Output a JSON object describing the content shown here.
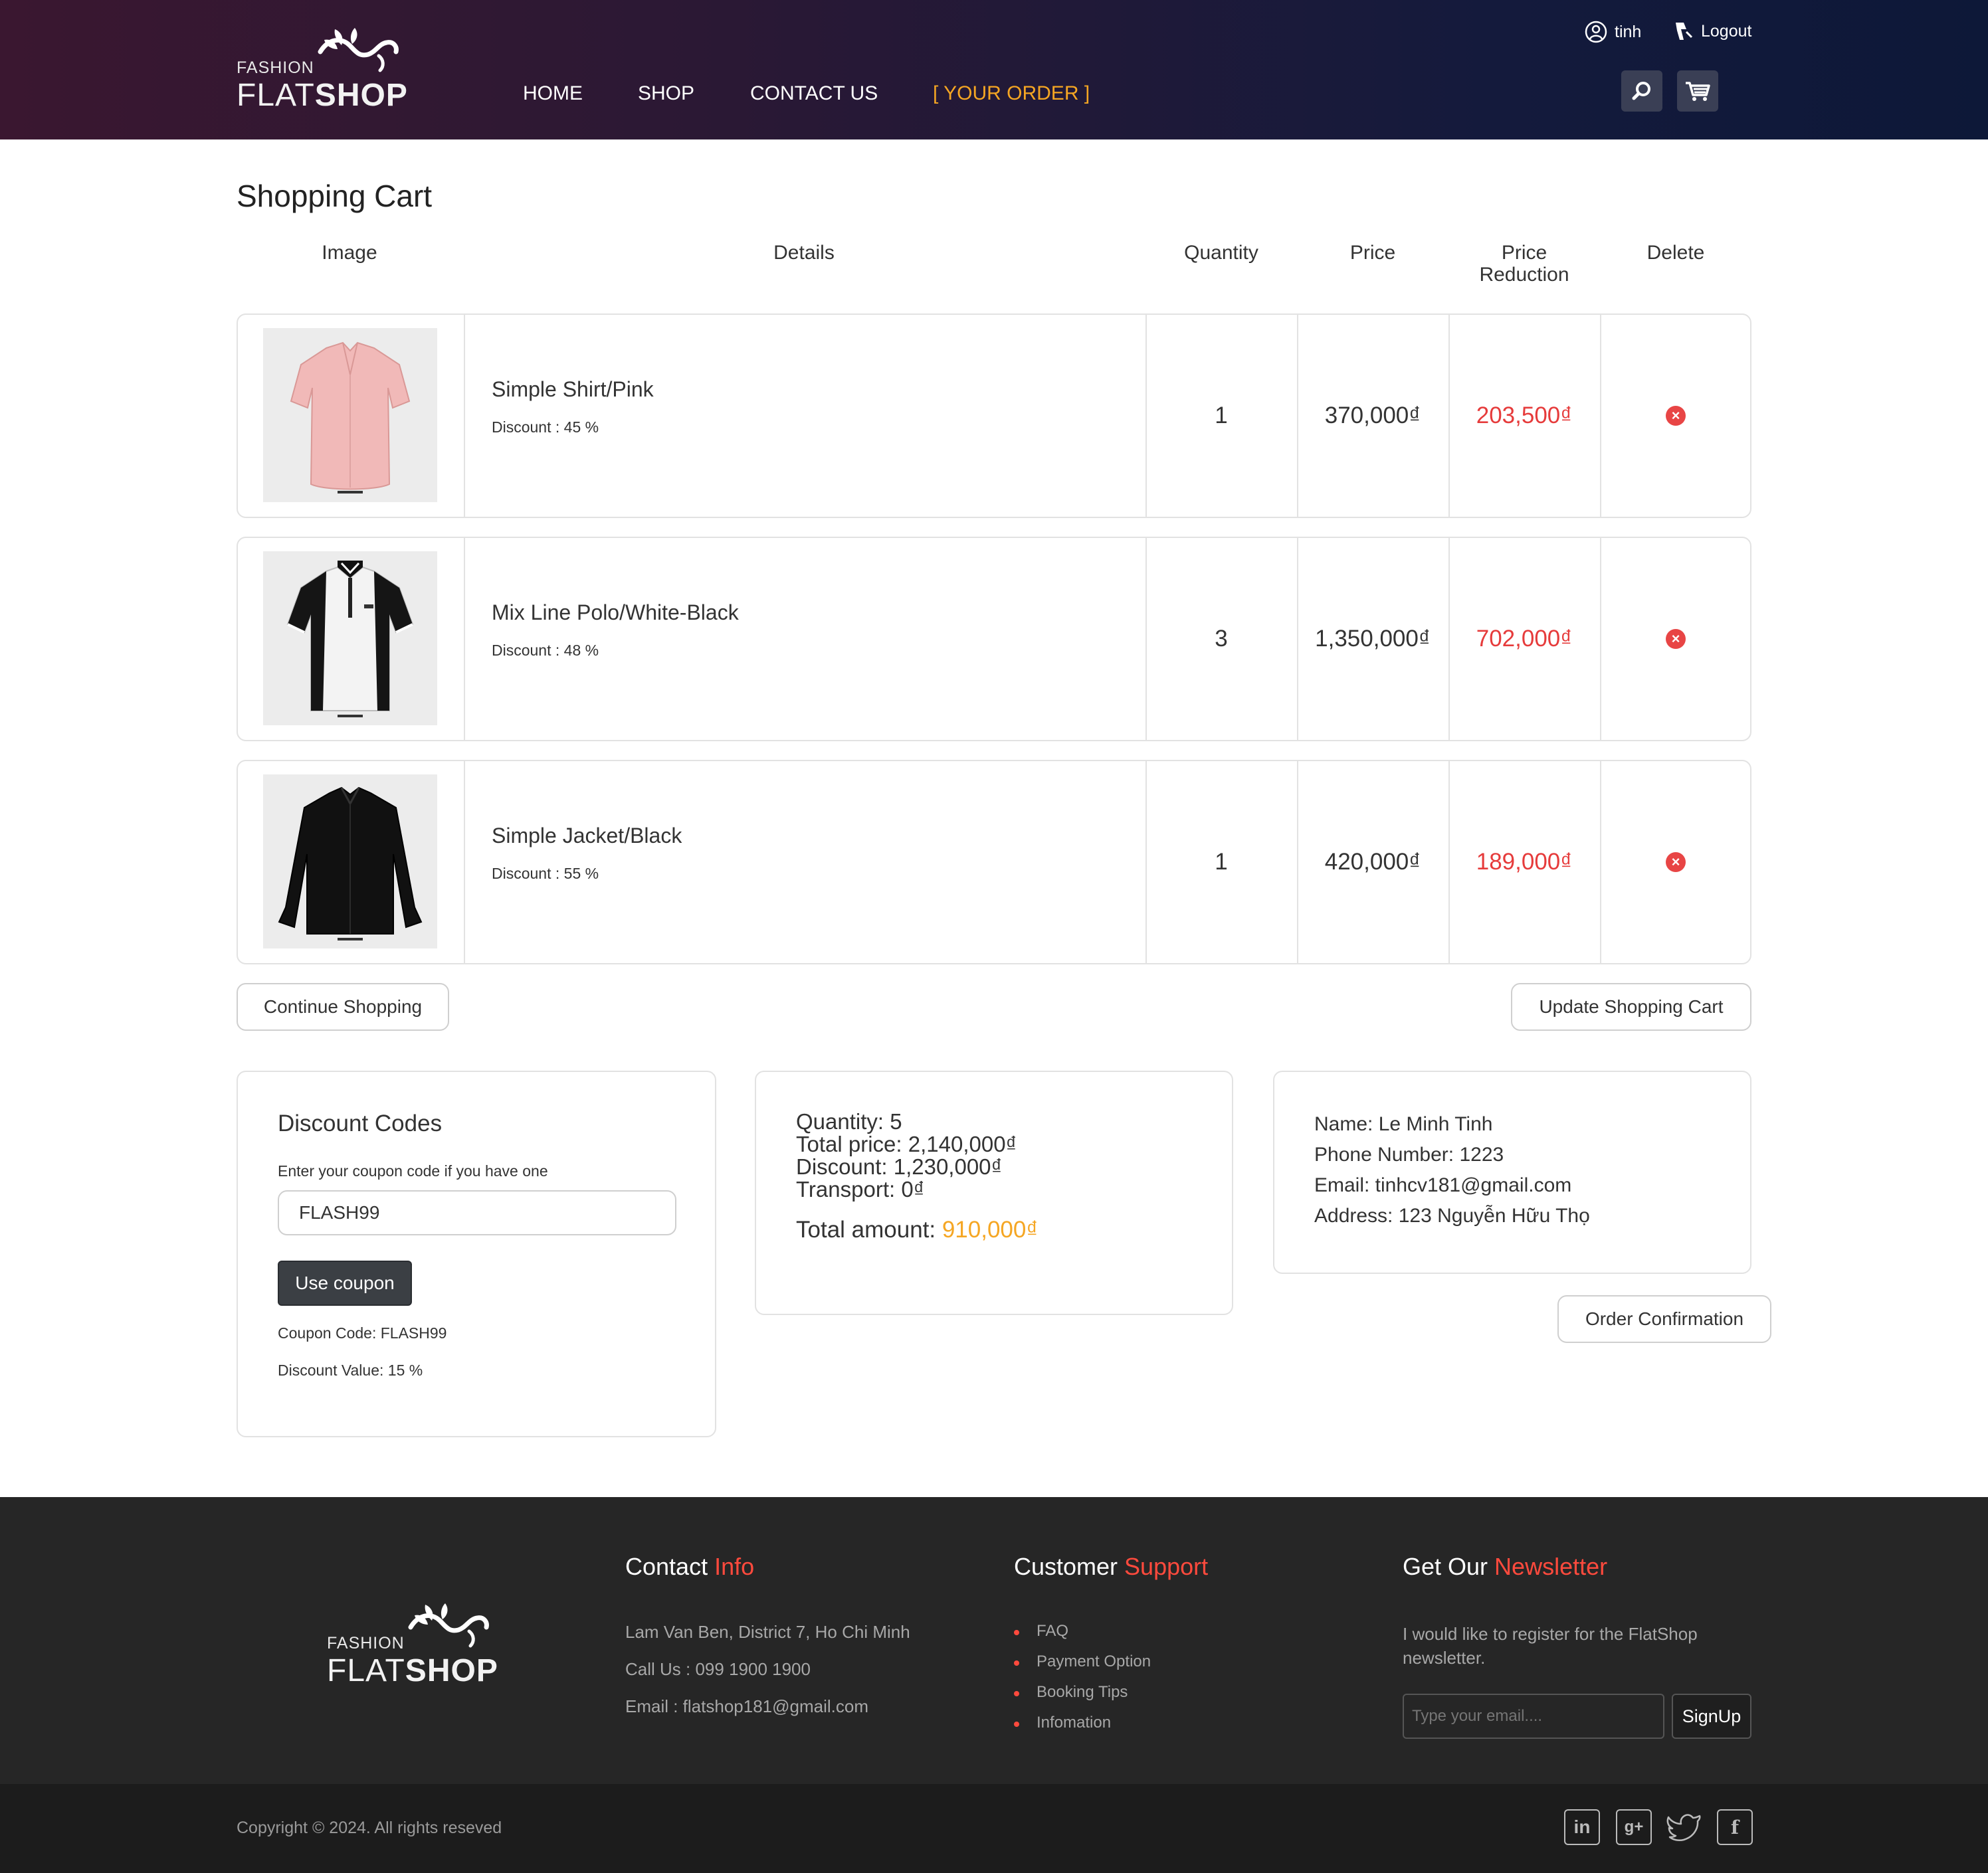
{
  "header": {
    "logo_top": "FASHION",
    "logo_flat": "FLAT",
    "logo_shop": "SHOP",
    "nav": [
      "HOME",
      "SHOP",
      "CONTACT US",
      "[ YOUR ORDER ]"
    ],
    "active_nav_color": "#f5a623",
    "user_name": "tinh",
    "logout_label": "Logout",
    "icons": [
      "user-icon",
      "logout-icon",
      "search-icon",
      "cart-icon"
    ]
  },
  "cart": {
    "title": "Shopping Cart",
    "headers": {
      "image": "Image",
      "details": "Details",
      "quantity": "Quantity",
      "price": "Price",
      "price_reduction": "Price Reduction",
      "delete": "Delete"
    },
    "items": [
      {
        "name": "Simple Shirt/Pink",
        "discount": "Discount : 45 %",
        "quantity": "1",
        "price": "370,000₫",
        "reduction": "203,500₫"
      },
      {
        "name": "Mix Line Polo/White-Black",
        "discount": "Discount : 48 %",
        "quantity": "3",
        "price": "1,350,000₫",
        "reduction": "702,000₫"
      },
      {
        "name": "Simple Jacket/Black",
        "discount": "Discount : 55 %",
        "quantity": "1",
        "price": "420,000₫",
        "reduction": "189,000₫"
      }
    ],
    "continue_label": "Continue Shopping",
    "update_label": "Update Shopping Cart"
  },
  "discount": {
    "title": "Discount Codes",
    "prompt": "Enter your coupon code if you have one",
    "input_value": "FLASH99",
    "use_label": "Use coupon",
    "coupon_code": "Coupon Code: FLASH99",
    "discount_value": "Discount Value: 15 %"
  },
  "summary": {
    "quantity": "Quantity: 5",
    "total_price": "Total price: 2,140,000₫",
    "discount": "Discount: 1,230,000₫",
    "transport": "Transport: 0₫",
    "total_label": "Total amount: ",
    "total_value": "910,000₫"
  },
  "customer": {
    "name": "Name: Le Minh Tinh",
    "phone": "Phone Number: 1223",
    "email": "Email: tinhcv181@gmail.com",
    "address": "Address: 123 Nguyễn Hữu Thọ",
    "confirm_label": "Order Confirmation"
  },
  "footer": {
    "contact_title_a": "Contact ",
    "contact_title_b": "Info",
    "contact_lines": [
      "Lam Van Ben, District 7, Ho Chi Minh",
      "Call Us : 099 1900 1900",
      "Email : flatshop181@gmail.com"
    ],
    "support_title_a": "Customer ",
    "support_title_b": "Support",
    "support_links": [
      "FAQ",
      "Payment Option",
      "Booking Tips",
      "Infomation"
    ],
    "news_title_a": "Get Our ",
    "news_title_b": "Newsletter",
    "news_text_1": "I would like to register for the FlatShop",
    "news_text_2": "newsletter.",
    "email_placeholder": "Type your email....",
    "signup_label": "SignUp",
    "copyright": "Copyright © 2024. All rights reseved",
    "social_icons": [
      "linkedin-icon",
      "google-plus-icon",
      "twitter-icon",
      "facebook-icon"
    ]
  }
}
